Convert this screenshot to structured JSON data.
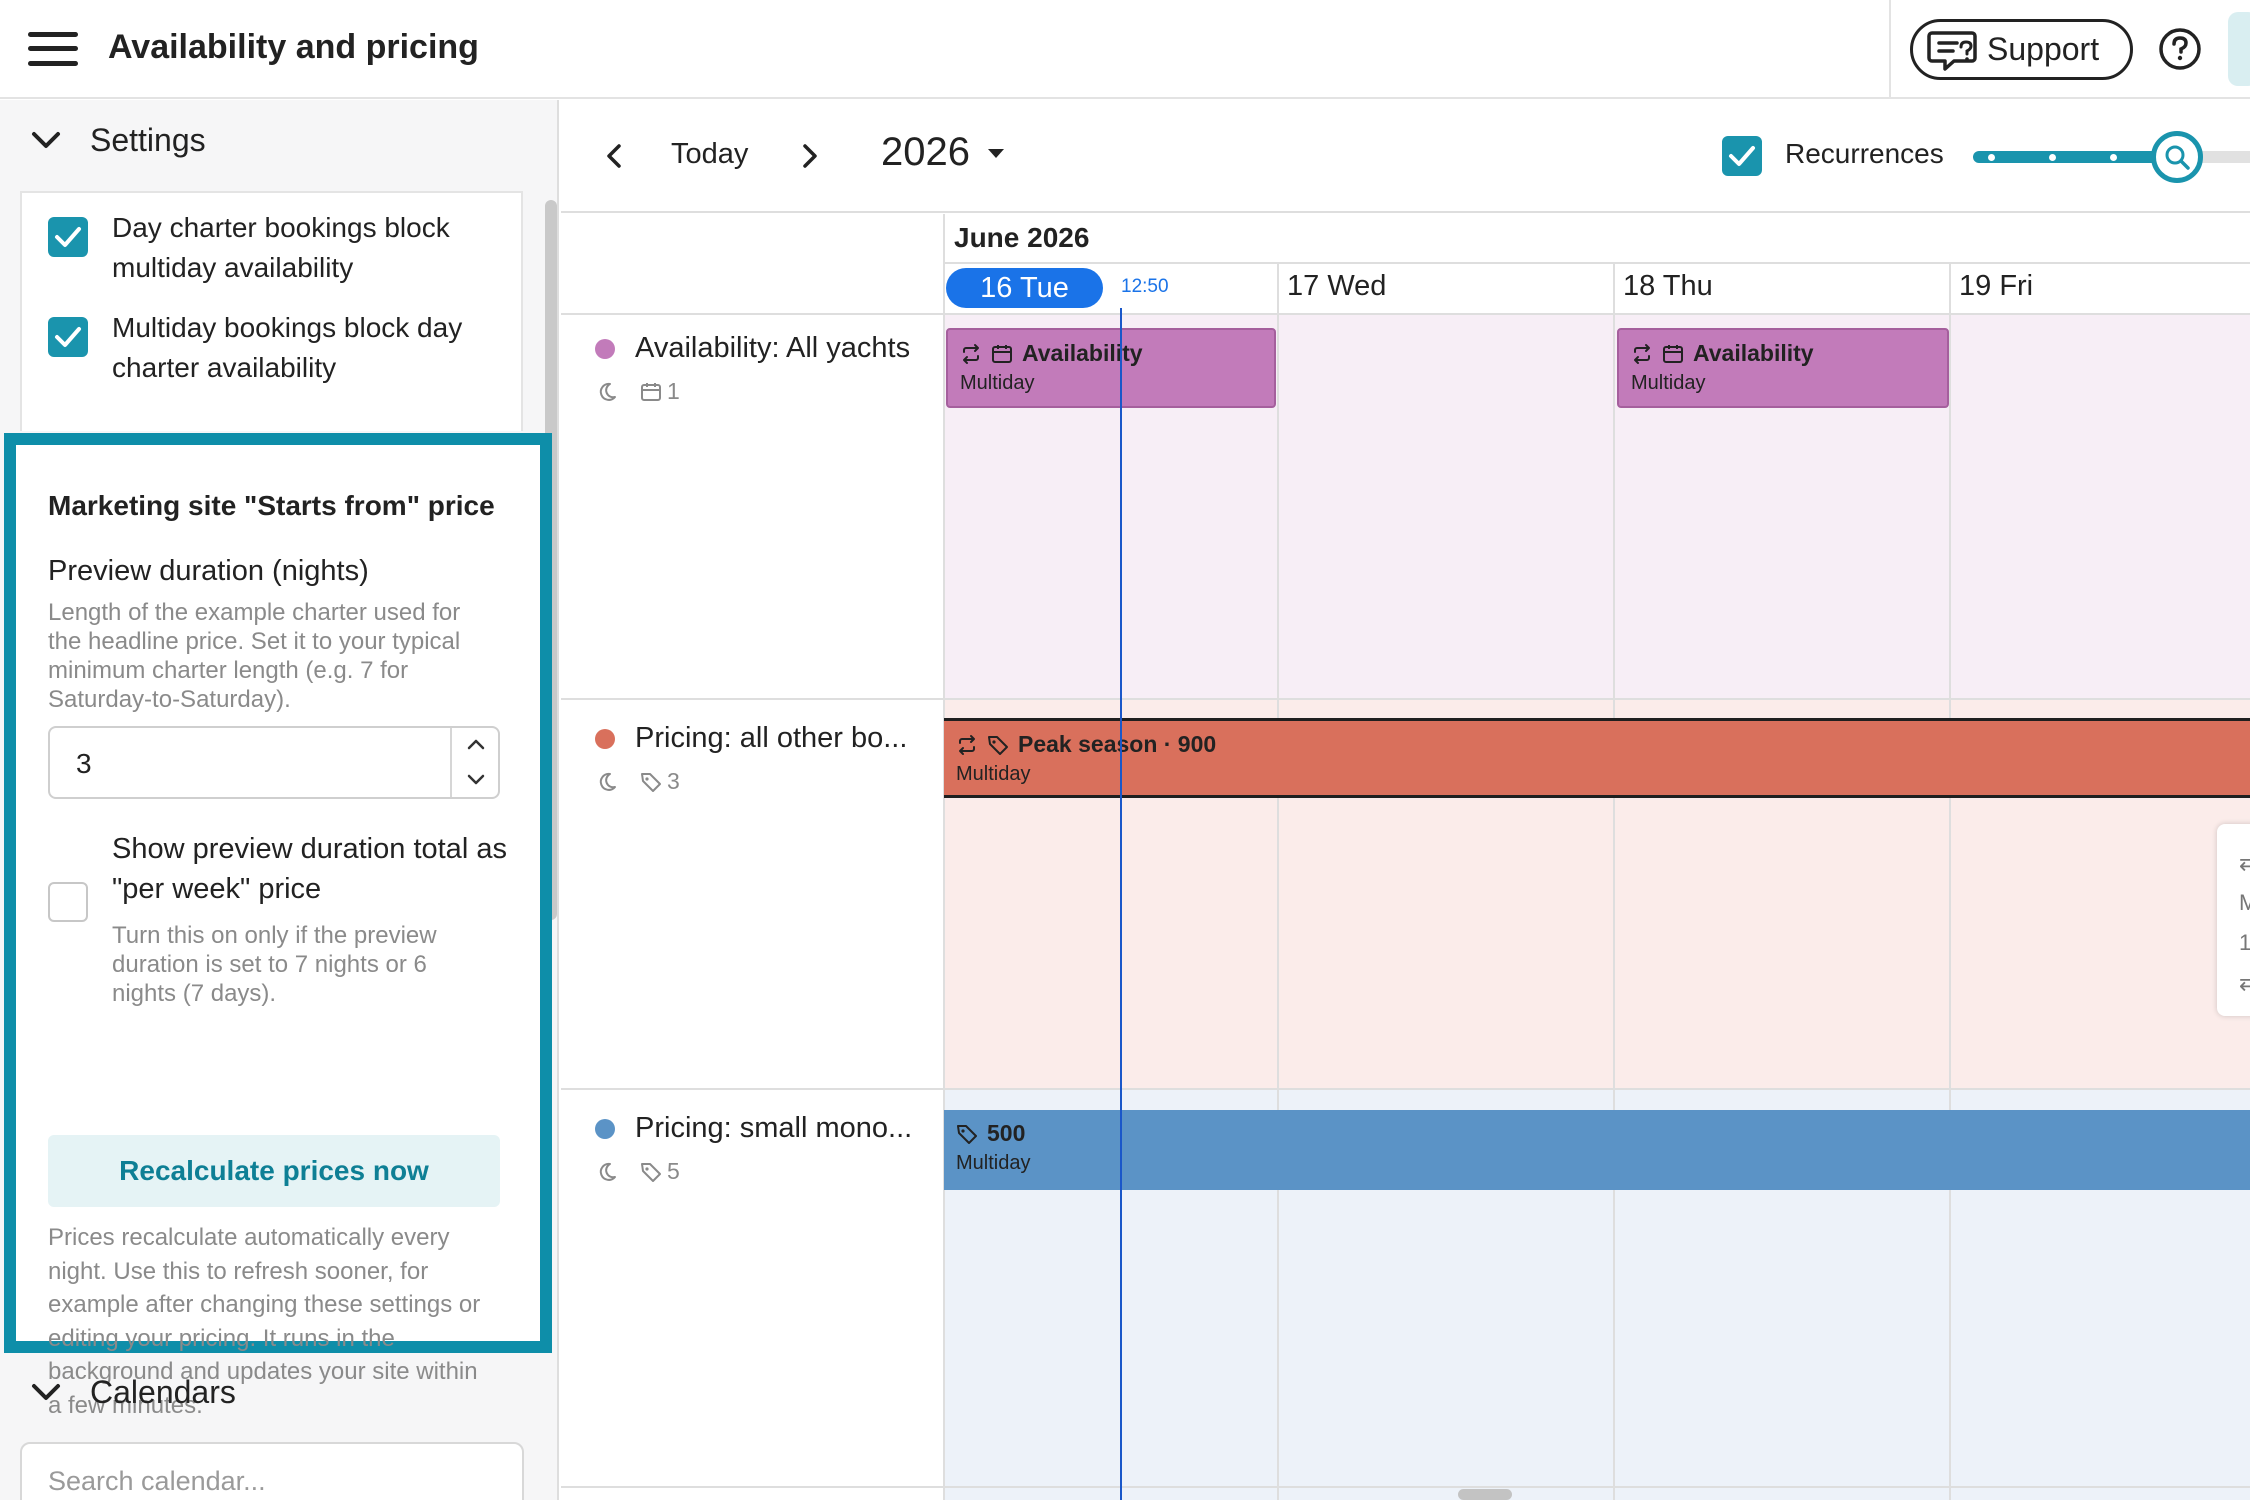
{
  "header": {
    "title": "Availability and pricing",
    "support_label": "Support"
  },
  "sidebar": {
    "settings": {
      "title": "Settings",
      "options": [
        {
          "line1": "Day charter bookings block",
          "line2": "multiday availability",
          "checked": true
        },
        {
          "line1": "Multiday bookings block day",
          "line2": "charter availability",
          "checked": true
        }
      ]
    },
    "marketing": {
      "title": "Marketing site \"Starts from\" price",
      "duration_label": "Preview duration (nights)",
      "duration_help": [
        "Length of the example charter used for",
        "the headline price. Set it to your typical",
        "minimum charter length (e.g. 7 for",
        "Saturday-to-Saturday)."
      ],
      "duration_value": "3",
      "per_week_label": [
        "Show preview duration total as",
        "\"per week\" price"
      ],
      "per_week_help": [
        "Turn this on only if the preview",
        "duration is set to 7 nights or 6",
        "nights (7 days)."
      ],
      "per_week_checked": false,
      "recalc_label": "Recalculate prices now",
      "recalc_help": [
        "Prices recalculate automatically every",
        "night. Use this to refresh sooner, for",
        "example after changing these settings or",
        "editing your pricing. It runs in the",
        "background and updates your site within",
        "a few minutes."
      ]
    },
    "calendars": {
      "title": "Calendars",
      "search_placeholder": "Search calendar..."
    }
  },
  "toolbar": {
    "today_label": "Today",
    "year": "2026",
    "recurrences_label": "Recurrences",
    "recurrences_checked": true
  },
  "calendar": {
    "month": "June 2026",
    "days": [
      {
        "label": "16 Tue",
        "today": true
      },
      {
        "label": "17 Wed",
        "today": false
      },
      {
        "label": "18 Thu",
        "today": false
      },
      {
        "label": "19 Fri",
        "today": false
      }
    ],
    "now_time": "12:50",
    "rows": [
      {
        "name": "Availability: All yachts",
        "color": "#c27bba",
        "meta_count": "1"
      },
      {
        "name": "Pricing: all other bo...",
        "color": "#d9705c",
        "meta_count": "3"
      },
      {
        "name": "Pricing: small mono...",
        "color": "#5b93c6",
        "meta_count": "5"
      }
    ],
    "events": [
      {
        "title": "Availability",
        "sub": "Multiday",
        "color": "#c27bba"
      },
      {
        "title": "Availability",
        "sub": "Multiday",
        "color": "#c27bba"
      },
      {
        "title": "Peak season · 900",
        "sub": "Multiday",
        "color": "#d9705c"
      },
      {
        "title": "500",
        "sub": "Multiday",
        "color": "#5b93c6"
      }
    ],
    "popover_glyphs": [
      "M",
      "1"
    ]
  },
  "colors": {
    "accent": "#1a94ad",
    "today": "#1a73e8",
    "highlight_border": "#0e8ea9"
  }
}
